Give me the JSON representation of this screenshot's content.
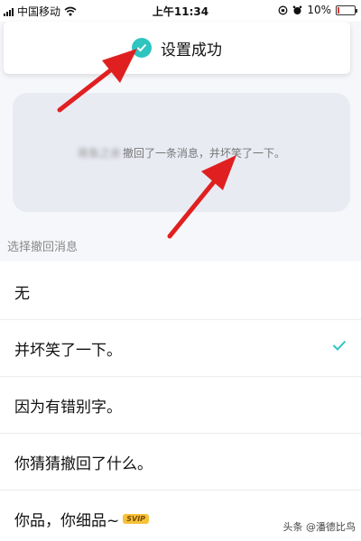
{
  "status_bar": {
    "carrier": "中国移动",
    "time": "上午11:34",
    "battery": "10%",
    "battery_level": 0.1
  },
  "toast": {
    "message": "设置成功",
    "icon": "check-circle-icon"
  },
  "preview": {
    "blurred_name": "蒋鱼之余",
    "text": "撤回了一条消息，并坏笑了一下。"
  },
  "section": {
    "title": "选择撤回消息"
  },
  "options": [
    {
      "label": "无",
      "selected": false
    },
    {
      "label": "并坏笑了一下。",
      "selected": true
    },
    {
      "label": "因为有错别字。",
      "selected": false
    },
    {
      "label": "你猜猜撤回了什么。",
      "selected": false
    },
    {
      "label": "你品，你细品~",
      "selected": false,
      "badge": "SVIP"
    }
  ],
  "watermark": "头条 @潘德比鸟",
  "colors": {
    "accent": "#2ec4c0",
    "annotation_arrow": "#e02020",
    "battery_low": "#e53935"
  }
}
